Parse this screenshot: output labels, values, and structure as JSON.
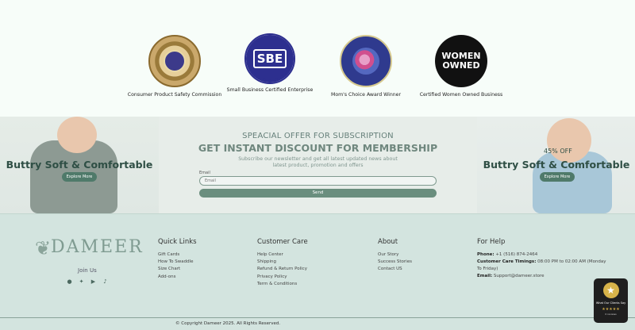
{
  "badges": [
    {
      "caption": "Consumer Product Safety Commission",
      "icon": "cpsc-seal-icon"
    },
    {
      "caption": "Small Business Certified Enterprise",
      "icon": "sbe-badge-icon",
      "logo_text": "SBE"
    },
    {
      "caption": "Mom's Choice Award Winner",
      "icon": "moms-choice-icon"
    },
    {
      "caption": "Certified Women Owned Business",
      "icon": "women-owned-icon",
      "logo_text_1": "WOMEN",
      "logo_text_2": "OWNED"
    }
  ],
  "promo": {
    "left": {
      "title": "Buttry Soft & Comfortable",
      "button": "Explore More"
    },
    "right": {
      "title": "Buttry Soft & Comfortable",
      "sale": "45% OFF",
      "button": "Explore More"
    },
    "kicker": "SPEACIAL OFFER FOR SUBSCRIPTION",
    "heading": "GET INSTANT DISCOUNT FOR MEMBERSHIP",
    "subtext_1": "Subscribe our newsletter and get all latest updated news about",
    "subtext_2": "latest product, promotion and offers",
    "email_label": "Email",
    "email_placeholder": "Email",
    "send_label": "Send"
  },
  "footer": {
    "brand": "DAMEER",
    "join_label": "Join Us",
    "socials": [
      "facebook-icon",
      "twitter-icon",
      "youtube-icon",
      "tiktok-icon"
    ],
    "quick_links": {
      "title": "Quick Links",
      "items": [
        "Gift Cards",
        "How To Swaddle",
        "Size Chart",
        "Add-ons"
      ]
    },
    "customer_care": {
      "title": "Customer Care",
      "items": [
        "Help Center",
        "Shipping",
        "Refund & Return Policy",
        "Privacy Policy",
        "Term & Conditions"
      ]
    },
    "about": {
      "title": "About",
      "items": [
        "Our Story",
        "Success Stories",
        "Contact US"
      ]
    },
    "help": {
      "title": "For Help",
      "phone_label": "Phone:",
      "phone": "+1 (516) 874-2464",
      "timings_label": "Customer Care Timings:",
      "timings": "08:00 PM to 02:00 AM (Monday To Friday)",
      "email_label": "Email:",
      "email": "Support@dameer.store"
    },
    "copyright": "© Copyright Dameer 2025. All Rights Reserved."
  },
  "reviews_widget": {
    "title": "What Our Clients Say",
    "stars": "★★★★★",
    "count": "0 reviews"
  }
}
